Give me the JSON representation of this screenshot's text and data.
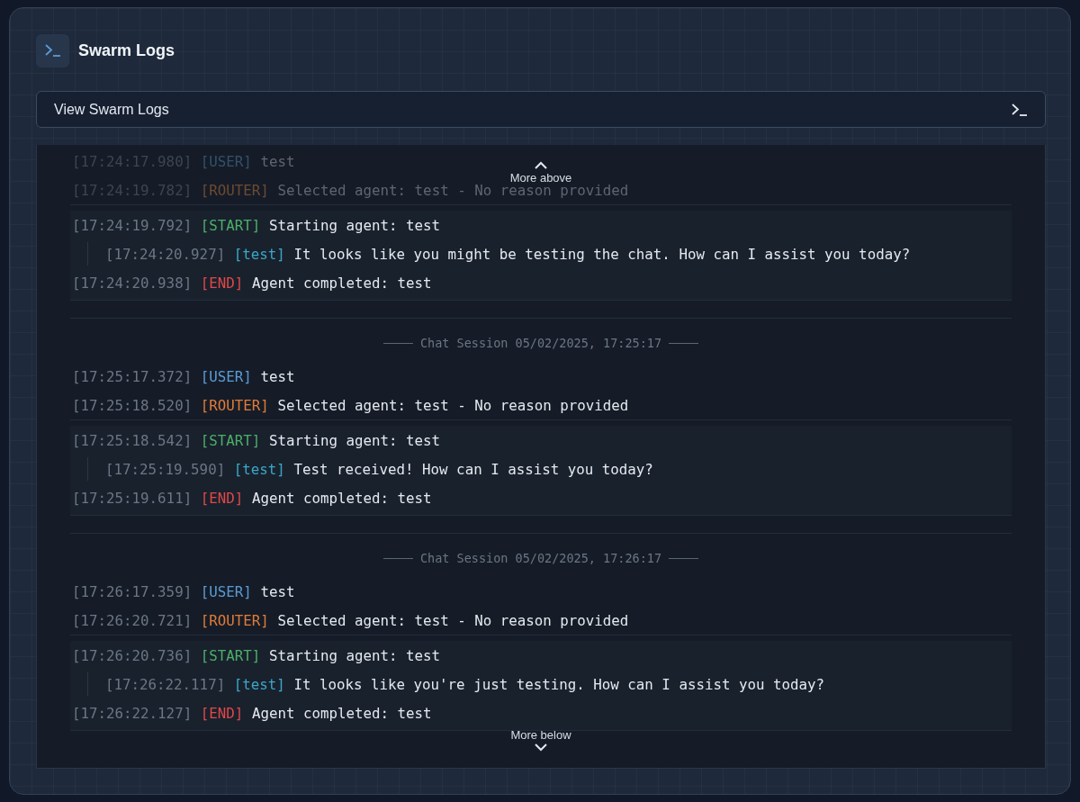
{
  "panel": {
    "title": "Swarm Logs"
  },
  "dropdown": {
    "label": "View Swarm Logs"
  },
  "scroll": {
    "more_above": "More above",
    "more_below": "More below"
  },
  "sessions": [
    {
      "entries": [
        {
          "kind": "log",
          "faded": true,
          "time": "[17:24:17.980]",
          "tag": "[USER]",
          "color": "#34506d",
          "text": "test"
        },
        {
          "kind": "log",
          "faded": true,
          "time": "[17:24:19.782]",
          "tag": "[ROUTER]",
          "color": "#6e4a33",
          "text": "Selected agent: test - No reason provided"
        },
        {
          "kind": "run",
          "children": [
            {
              "kind": "log",
              "time": "[17:24:19.792]",
              "tag": "[START]",
              "color": "#4caf68",
              "text": "Starting agent: test"
            },
            {
              "kind": "reply",
              "time": "[17:24:20.927]",
              "tag": "[test]",
              "color": "#3aa8c8",
              "text": "It looks like you might be testing the chat. How can I assist you today?"
            },
            {
              "kind": "log",
              "time": "[17:24:20.938]",
              "tag": "[END]",
              "color": "#e04848",
              "text": "Agent completed: test"
            }
          ]
        }
      ]
    },
    {
      "header": "Chat Session 05/02/2025, 17:25:17",
      "entries": [
        {
          "kind": "log",
          "time": "[17:25:17.372]",
          "tag": "[USER]",
          "color": "#5b9bd5",
          "text": "test"
        },
        {
          "kind": "log",
          "time": "[17:25:18.520]",
          "tag": "[ROUTER]",
          "color": "#e07b39",
          "text": "Selected agent: test - No reason provided"
        },
        {
          "kind": "run",
          "children": [
            {
              "kind": "log",
              "time": "[17:25:18.542]",
              "tag": "[START]",
              "color": "#4caf68",
              "text": "Starting agent: test"
            },
            {
              "kind": "reply",
              "time": "[17:25:19.590]",
              "tag": "[test]",
              "color": "#3aa8c8",
              "text": "Test received! How can I assist you today?"
            },
            {
              "kind": "log",
              "time": "[17:25:19.611]",
              "tag": "[END]",
              "color": "#e04848",
              "text": "Agent completed: test"
            }
          ]
        }
      ]
    },
    {
      "header": "Chat Session 05/02/2025, 17:26:17",
      "entries": [
        {
          "kind": "log",
          "time": "[17:26:17.359]",
          "tag": "[USER]",
          "color": "#5b9bd5",
          "text": "test"
        },
        {
          "kind": "log",
          "time": "[17:26:20.721]",
          "tag": "[ROUTER]",
          "color": "#e07b39",
          "text": "Selected agent: test - No reason provided"
        },
        {
          "kind": "run",
          "children": [
            {
              "kind": "log",
              "time": "[17:26:20.736]",
              "tag": "[START]",
              "color": "#4caf68",
              "text": "Starting agent: test"
            },
            {
              "kind": "reply",
              "time": "[17:26:22.117]",
              "tag": "[test]",
              "color": "#3aa8c8",
              "text": "It looks like you're just testing. How can I assist you today?"
            },
            {
              "kind": "log",
              "time": "[17:26:22.127]",
              "tag": "[END]",
              "color": "#e04848",
              "text": "Agent completed: test"
            }
          ]
        }
      ]
    }
  ]
}
